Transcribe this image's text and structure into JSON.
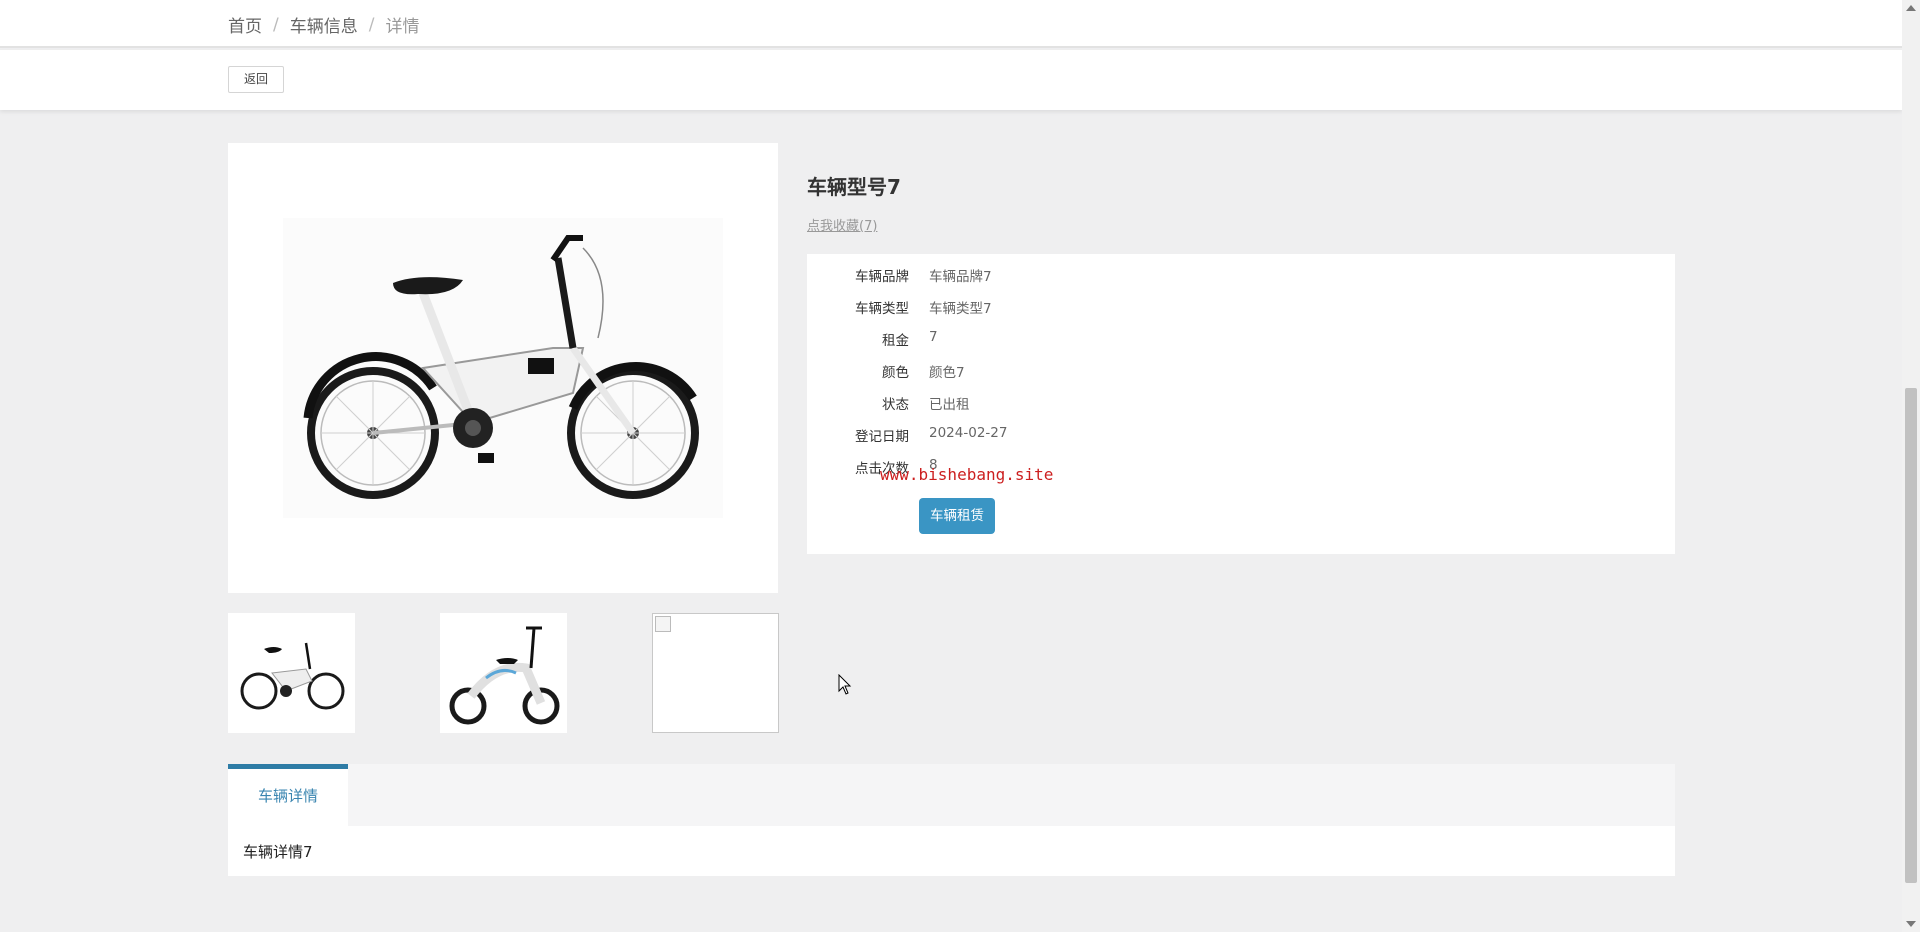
{
  "breadcrumb": {
    "home": "首页",
    "list": "车辆信息",
    "current": "详情",
    "separator": "/"
  },
  "toolbar": {
    "back_label": "返回"
  },
  "product": {
    "title": "车辆型号7",
    "favorite_label": "点我收藏(7)",
    "fields": [
      {
        "label": "车辆品牌",
        "value": "车辆品牌7"
      },
      {
        "label": "车辆类型",
        "value": "车辆类型7"
      },
      {
        "label": "租金",
        "value": "7"
      },
      {
        "label": "颜色",
        "value": "颜色7"
      },
      {
        "label": "状态",
        "value": "已出租"
      },
      {
        "label": "登记日期",
        "value": "2024-02-27"
      },
      {
        "label": "点击次数",
        "value": "8"
      }
    ],
    "rent_button": "车辆租赁"
  },
  "watermark": "www.bishebang.site",
  "tabs": [
    {
      "label": "车辆详情"
    }
  ],
  "tab_content": "车辆详情7",
  "colors": {
    "accent": "#3a95c4",
    "tab_border": "#2e7ca6",
    "watermark": "#cc1f1f"
  }
}
